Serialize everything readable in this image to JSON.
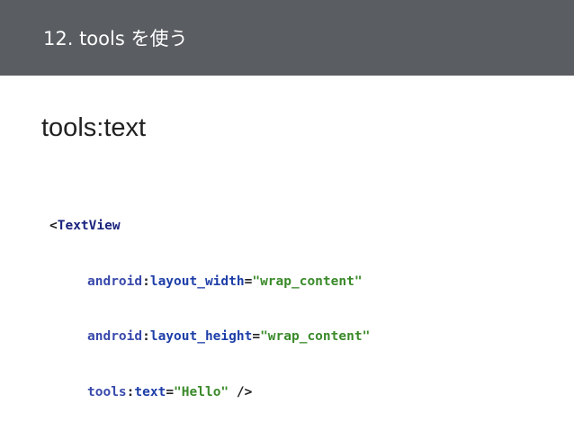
{
  "header": {
    "title": "12. tools を使う",
    "background_color": "#5a5d62"
  },
  "subheading": "tools:text",
  "code": {
    "open_bracket": "<",
    "tag_name": "TextView",
    "lines": [
      {
        "namespace": "android",
        "colon": ":",
        "attribute": "layout_width",
        "equals": "=",
        "value": "\"wrap_content\"",
        "suffix": ""
      },
      {
        "namespace": "android",
        "colon": ":",
        "attribute": "layout_height",
        "equals": "=",
        "value": "\"wrap_content\"",
        "suffix": ""
      },
      {
        "namespace": "tools",
        "colon": ":",
        "attribute": "text",
        "equals": "=",
        "value": "\"Hello\"",
        "suffix": " />"
      }
    ],
    "colors": {
      "tag": "#1a237e",
      "namespace": "#3949ab",
      "attribute": "#1e3fa8",
      "value": "#3a8a2a"
    }
  }
}
